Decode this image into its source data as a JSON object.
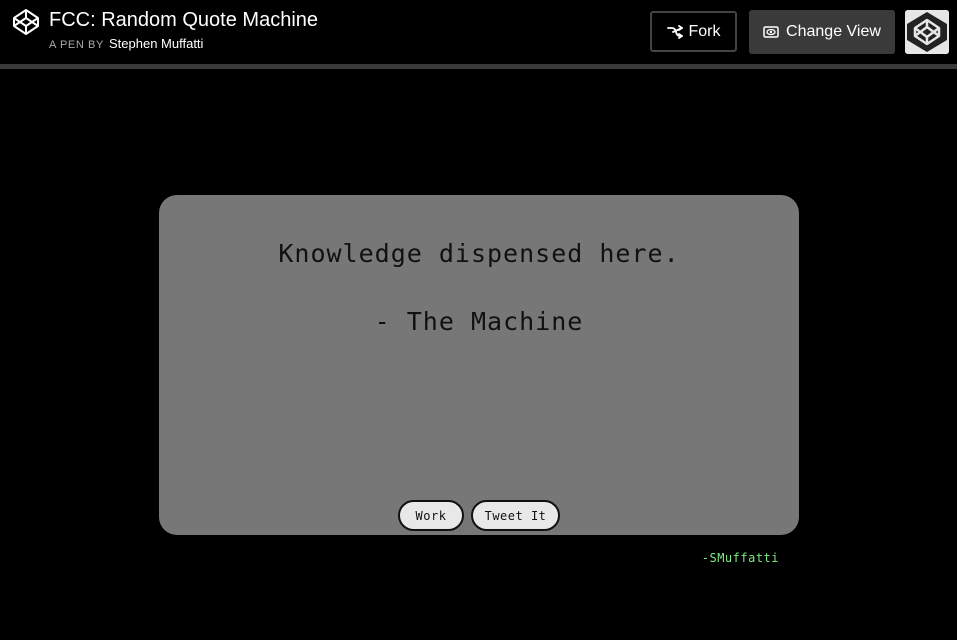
{
  "header": {
    "title": "FCC: Random Quote Machine",
    "byline_prefix": "A PEN BY",
    "author": "Stephen Muffatti",
    "logo_icon": "codepen-logo-icon",
    "fork_label": "Fork",
    "fork_icon": "fork-icon",
    "change_view_label": "Change View",
    "change_view_icon": "eye-icon",
    "avatar_icon": "codepen-avatar-icon"
  },
  "quote": {
    "text": "Knowledge dispensed here.",
    "author": "- The Machine",
    "work_label": "Work",
    "tweet_label": "Tweet It"
  },
  "footer": {
    "credit": "-SMuffatti"
  },
  "colors": {
    "background": "#000000",
    "card": "#777777",
    "credit": "#7ee787",
    "header_rule": "#3a3a3a"
  }
}
